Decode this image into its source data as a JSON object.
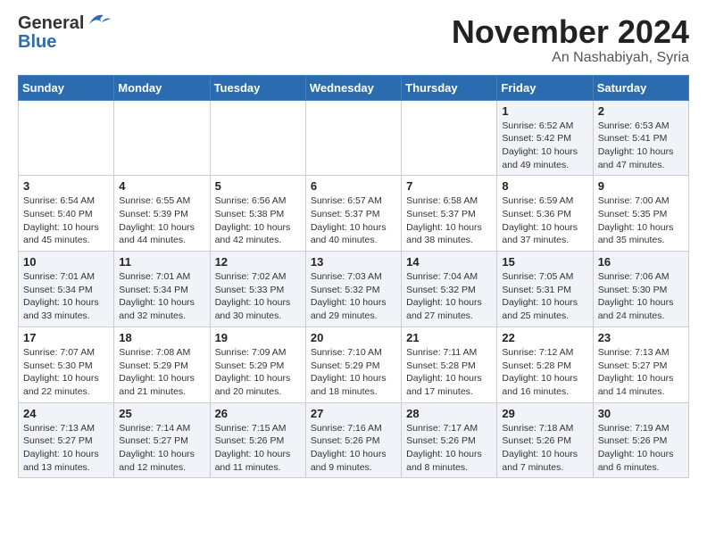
{
  "header": {
    "logo_general": "General",
    "logo_blue": "Blue",
    "month_title": "November 2024",
    "location": "An Nashabiyah, Syria"
  },
  "weekdays": [
    "Sunday",
    "Monday",
    "Tuesday",
    "Wednesday",
    "Thursday",
    "Friday",
    "Saturday"
  ],
  "weeks": [
    [
      {
        "day": "",
        "info": ""
      },
      {
        "day": "",
        "info": ""
      },
      {
        "day": "",
        "info": ""
      },
      {
        "day": "",
        "info": ""
      },
      {
        "day": "",
        "info": ""
      },
      {
        "day": "1",
        "info": "Sunrise: 6:52 AM\nSunset: 5:42 PM\nDaylight: 10 hours\nand 49 minutes."
      },
      {
        "day": "2",
        "info": "Sunrise: 6:53 AM\nSunset: 5:41 PM\nDaylight: 10 hours\nand 47 minutes."
      }
    ],
    [
      {
        "day": "3",
        "info": "Sunrise: 6:54 AM\nSunset: 5:40 PM\nDaylight: 10 hours\nand 45 minutes."
      },
      {
        "day": "4",
        "info": "Sunrise: 6:55 AM\nSunset: 5:39 PM\nDaylight: 10 hours\nand 44 minutes."
      },
      {
        "day": "5",
        "info": "Sunrise: 6:56 AM\nSunset: 5:38 PM\nDaylight: 10 hours\nand 42 minutes."
      },
      {
        "day": "6",
        "info": "Sunrise: 6:57 AM\nSunset: 5:37 PM\nDaylight: 10 hours\nand 40 minutes."
      },
      {
        "day": "7",
        "info": "Sunrise: 6:58 AM\nSunset: 5:37 PM\nDaylight: 10 hours\nand 38 minutes."
      },
      {
        "day": "8",
        "info": "Sunrise: 6:59 AM\nSunset: 5:36 PM\nDaylight: 10 hours\nand 37 minutes."
      },
      {
        "day": "9",
        "info": "Sunrise: 7:00 AM\nSunset: 5:35 PM\nDaylight: 10 hours\nand 35 minutes."
      }
    ],
    [
      {
        "day": "10",
        "info": "Sunrise: 7:01 AM\nSunset: 5:34 PM\nDaylight: 10 hours\nand 33 minutes."
      },
      {
        "day": "11",
        "info": "Sunrise: 7:01 AM\nSunset: 5:34 PM\nDaylight: 10 hours\nand 32 minutes."
      },
      {
        "day": "12",
        "info": "Sunrise: 7:02 AM\nSunset: 5:33 PM\nDaylight: 10 hours\nand 30 minutes."
      },
      {
        "day": "13",
        "info": "Sunrise: 7:03 AM\nSunset: 5:32 PM\nDaylight: 10 hours\nand 29 minutes."
      },
      {
        "day": "14",
        "info": "Sunrise: 7:04 AM\nSunset: 5:32 PM\nDaylight: 10 hours\nand 27 minutes."
      },
      {
        "day": "15",
        "info": "Sunrise: 7:05 AM\nSunset: 5:31 PM\nDaylight: 10 hours\nand 25 minutes."
      },
      {
        "day": "16",
        "info": "Sunrise: 7:06 AM\nSunset: 5:30 PM\nDaylight: 10 hours\nand 24 minutes."
      }
    ],
    [
      {
        "day": "17",
        "info": "Sunrise: 7:07 AM\nSunset: 5:30 PM\nDaylight: 10 hours\nand 22 minutes."
      },
      {
        "day": "18",
        "info": "Sunrise: 7:08 AM\nSunset: 5:29 PM\nDaylight: 10 hours\nand 21 minutes."
      },
      {
        "day": "19",
        "info": "Sunrise: 7:09 AM\nSunset: 5:29 PM\nDaylight: 10 hours\nand 20 minutes."
      },
      {
        "day": "20",
        "info": "Sunrise: 7:10 AM\nSunset: 5:29 PM\nDaylight: 10 hours\nand 18 minutes."
      },
      {
        "day": "21",
        "info": "Sunrise: 7:11 AM\nSunset: 5:28 PM\nDaylight: 10 hours\nand 17 minutes."
      },
      {
        "day": "22",
        "info": "Sunrise: 7:12 AM\nSunset: 5:28 PM\nDaylight: 10 hours\nand 16 minutes."
      },
      {
        "day": "23",
        "info": "Sunrise: 7:13 AM\nSunset: 5:27 PM\nDaylight: 10 hours\nand 14 minutes."
      }
    ],
    [
      {
        "day": "24",
        "info": "Sunrise: 7:13 AM\nSunset: 5:27 PM\nDaylight: 10 hours\nand 13 minutes."
      },
      {
        "day": "25",
        "info": "Sunrise: 7:14 AM\nSunset: 5:27 PM\nDaylight: 10 hours\nand 12 minutes."
      },
      {
        "day": "26",
        "info": "Sunrise: 7:15 AM\nSunset: 5:26 PM\nDaylight: 10 hours\nand 11 minutes."
      },
      {
        "day": "27",
        "info": "Sunrise: 7:16 AM\nSunset: 5:26 PM\nDaylight: 10 hours\nand 9 minutes."
      },
      {
        "day": "28",
        "info": "Sunrise: 7:17 AM\nSunset: 5:26 PM\nDaylight: 10 hours\nand 8 minutes."
      },
      {
        "day": "29",
        "info": "Sunrise: 7:18 AM\nSunset: 5:26 PM\nDaylight: 10 hours\nand 7 minutes."
      },
      {
        "day": "30",
        "info": "Sunrise: 7:19 AM\nSunset: 5:26 PM\nDaylight: 10 hours\nand 6 minutes."
      }
    ]
  ]
}
